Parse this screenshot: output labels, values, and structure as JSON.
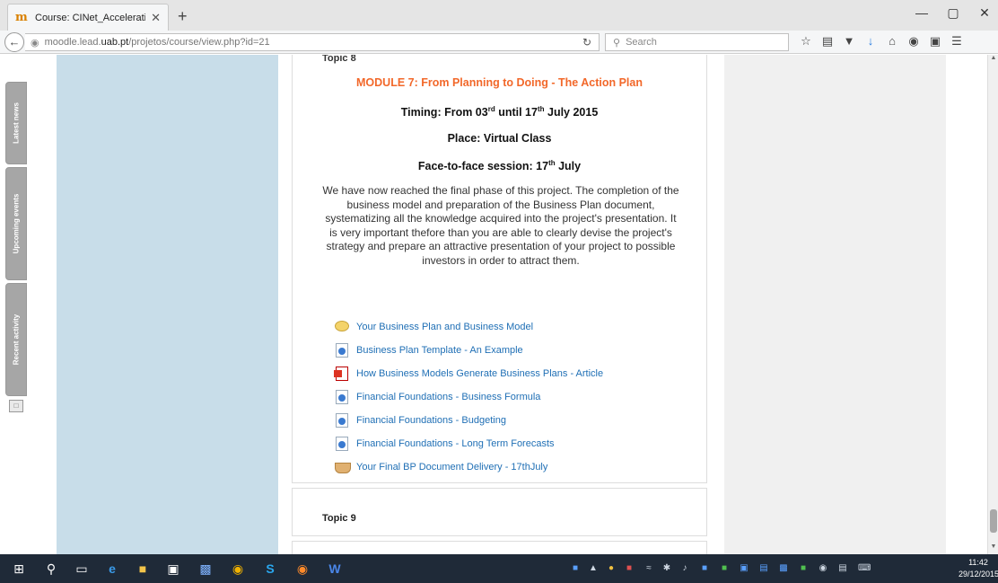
{
  "browser": {
    "tab_title": "Course: CINet_Acceleratin...",
    "tab_close": "✕",
    "new_tab": "+",
    "url_prefix": "moodle.lead.",
    "url_host": "uab.pt",
    "url_suffix": "/projetos/course/view.php?id=21",
    "search_placeholder": "Search",
    "window_controls": {
      "minimize": "—",
      "restore": "▢",
      "close": "✕"
    }
  },
  "sidebar_tabs": [
    {
      "label": "Latest news"
    },
    {
      "label": "Upcoming events"
    },
    {
      "label": "Recent activity"
    }
  ],
  "topic8": {
    "heading": "Topic 8",
    "module_title": "MODULE 7: From Planning to Doing - The Action Plan",
    "timing_prefix": "Timing: From 03",
    "timing_sup1": "rd",
    "timing_mid": " until 17",
    "timing_sup2": "th",
    "timing_suffix": " July 2015",
    "place": "Place: Virtual Class",
    "f2f_prefix": "Face-to-face session: 17",
    "f2f_sup": "th",
    "f2f_suffix": " July",
    "description": "We have now reached the final phase of this project. The completion of the business model and preparation of the Business Plan document, systematizing all the knowledge acquired into the project's presentation. It is very important thefore than you are able to clearly devise the project's strategy and prepare an attractive presentation of your project to possible investors in order to attract them.",
    "activities": [
      {
        "label": "Your Business Plan and Business Model",
        "icon": "forum-icon"
      },
      {
        "label": "Business Plan Template - An Example",
        "icon": "page-icon"
      },
      {
        "label": "How Business Models Generate Business Plans - Article",
        "icon": "pdf-icon"
      },
      {
        "label": "Financial Foundations - Business Formula",
        "icon": "page-icon"
      },
      {
        "label": "Financial Foundations - Budgeting",
        "icon": "page-icon"
      },
      {
        "label": "Financial Foundations - Long Term Forecasts",
        "icon": "page-icon"
      },
      {
        "label": "Your Final BP Document Delivery - 17thJuly",
        "icon": "assignment-icon"
      }
    ]
  },
  "topic9": {
    "heading": "Topic 9"
  },
  "taskbar": {
    "time": "11:42",
    "date": "29/12/2015"
  }
}
